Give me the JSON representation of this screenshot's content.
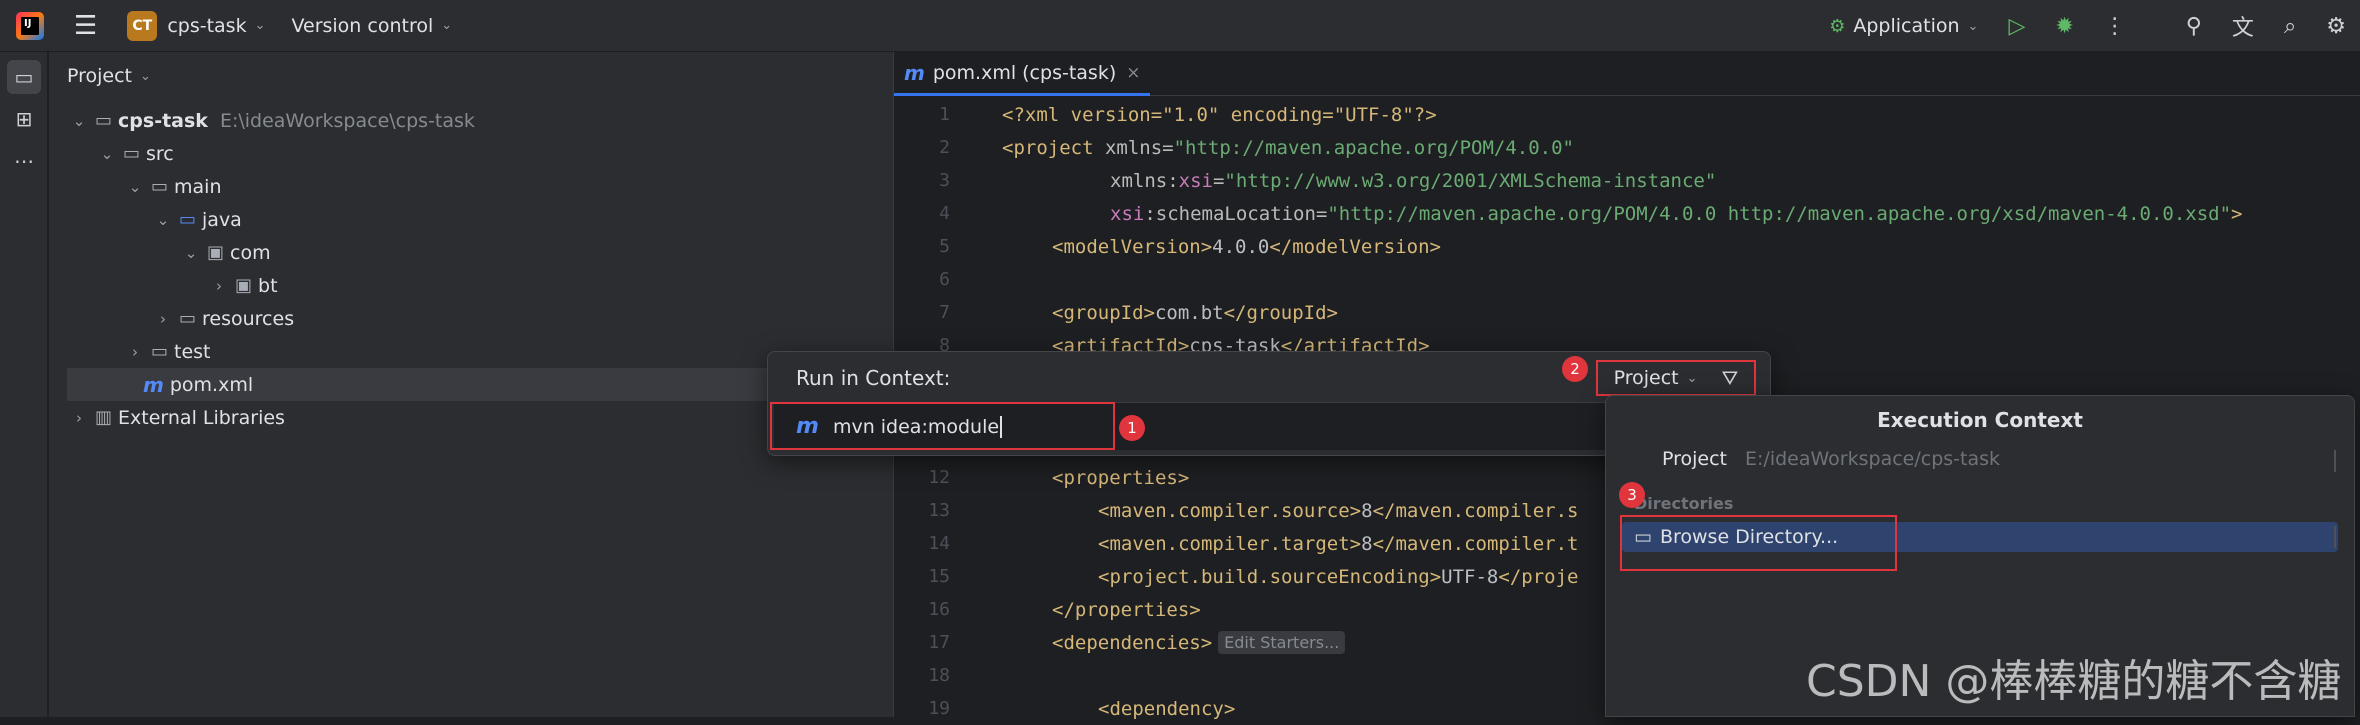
{
  "titlebar": {
    "project_badge": "CT",
    "project_name": "cps-task",
    "version_control": "Version control",
    "run_config": "Application"
  },
  "project_panel": {
    "title": "Project",
    "tree": [
      {
        "label": "cps-task",
        "path": "E:\\ideaWorkspace\\cps-task"
      },
      {
        "label": "src"
      },
      {
        "label": "main"
      },
      {
        "label": "java"
      },
      {
        "label": "com"
      },
      {
        "label": "bt"
      },
      {
        "label": "resources"
      },
      {
        "label": "test"
      },
      {
        "label": "pom.xml"
      },
      {
        "label": "External Libraries"
      }
    ]
  },
  "editor": {
    "tab_label": "pom.xml (cps-task)",
    "lines": [
      {
        "n": "1"
      },
      {
        "n": "2"
      },
      {
        "n": "3"
      },
      {
        "n": "4"
      },
      {
        "n": "5"
      },
      {
        "n": "6"
      },
      {
        "n": "7"
      },
      {
        "n": "8"
      },
      {
        "n": "12"
      },
      {
        "n": "13"
      },
      {
        "n": "14"
      },
      {
        "n": "15"
      },
      {
        "n": "16"
      },
      {
        "n": "17"
      },
      {
        "n": "18"
      },
      {
        "n": "19"
      }
    ],
    "code": {
      "l1": "<?xml version=\"1.0\" encoding=\"UTF-8\"?>",
      "l2_tag": "<project",
      "l2_attr": " xmlns=",
      "l2_val": "\"http://maven.apache.org/POM/4.0.0\"",
      "l3_attr": "xmlns:",
      "l3_ns": "xsi",
      "l3_eq": "=",
      "l3_val": "\"http://www.w3.org/2001/XMLSchema-instance\"",
      "l4_ns": "xsi",
      "l4_attr": ":schemaLocation=",
      "l4_val": "\"http://maven.apache.org/POM/4.0.0 http://maven.apache.org/xsd/maven-4.0.0.xsd\"",
      "l4_end": ">",
      "l5_open": "<modelVersion>",
      "l5_txt": "4.0.0",
      "l5_close": "</modelVersion>",
      "l7_open": "<groupId>",
      "l7_txt": "com.bt",
      "l7_close": "</groupId>",
      "l8_open": "<artifactId>",
      "l8_txt": "cps-task",
      "l8_close": "</artifactId>",
      "l12": "<properties>",
      "l13_open": "<maven.compiler.source>",
      "l13_txt": "8",
      "l13_close": "</maven.compiler.s",
      "l14_open": "<maven.compiler.target>",
      "l14_txt": "8",
      "l14_close": "</maven.compiler.t",
      "l15_open": "<project.build.sourceEncoding>",
      "l15_txt": "UTF-8",
      "l15_close": "</proje",
      "l16": "</properties>",
      "l17": "<dependencies>",
      "l17_hint": "Edit Starters...",
      "l19": "<dependency>"
    }
  },
  "run_popup": {
    "title": "Run in Context:",
    "scope": "Project",
    "command": "mvn  idea:module"
  },
  "exec_context": {
    "title": "Execution Context",
    "project_key": "Project",
    "project_value": "E:/ideaWorkspace/cps-task",
    "section": "Directories",
    "browse": "Browse Directory..."
  },
  "annotations": {
    "b1": "1",
    "b2": "2",
    "b3": "3"
  },
  "watermark": "CSDN @棒棒糖的糖不含糖"
}
